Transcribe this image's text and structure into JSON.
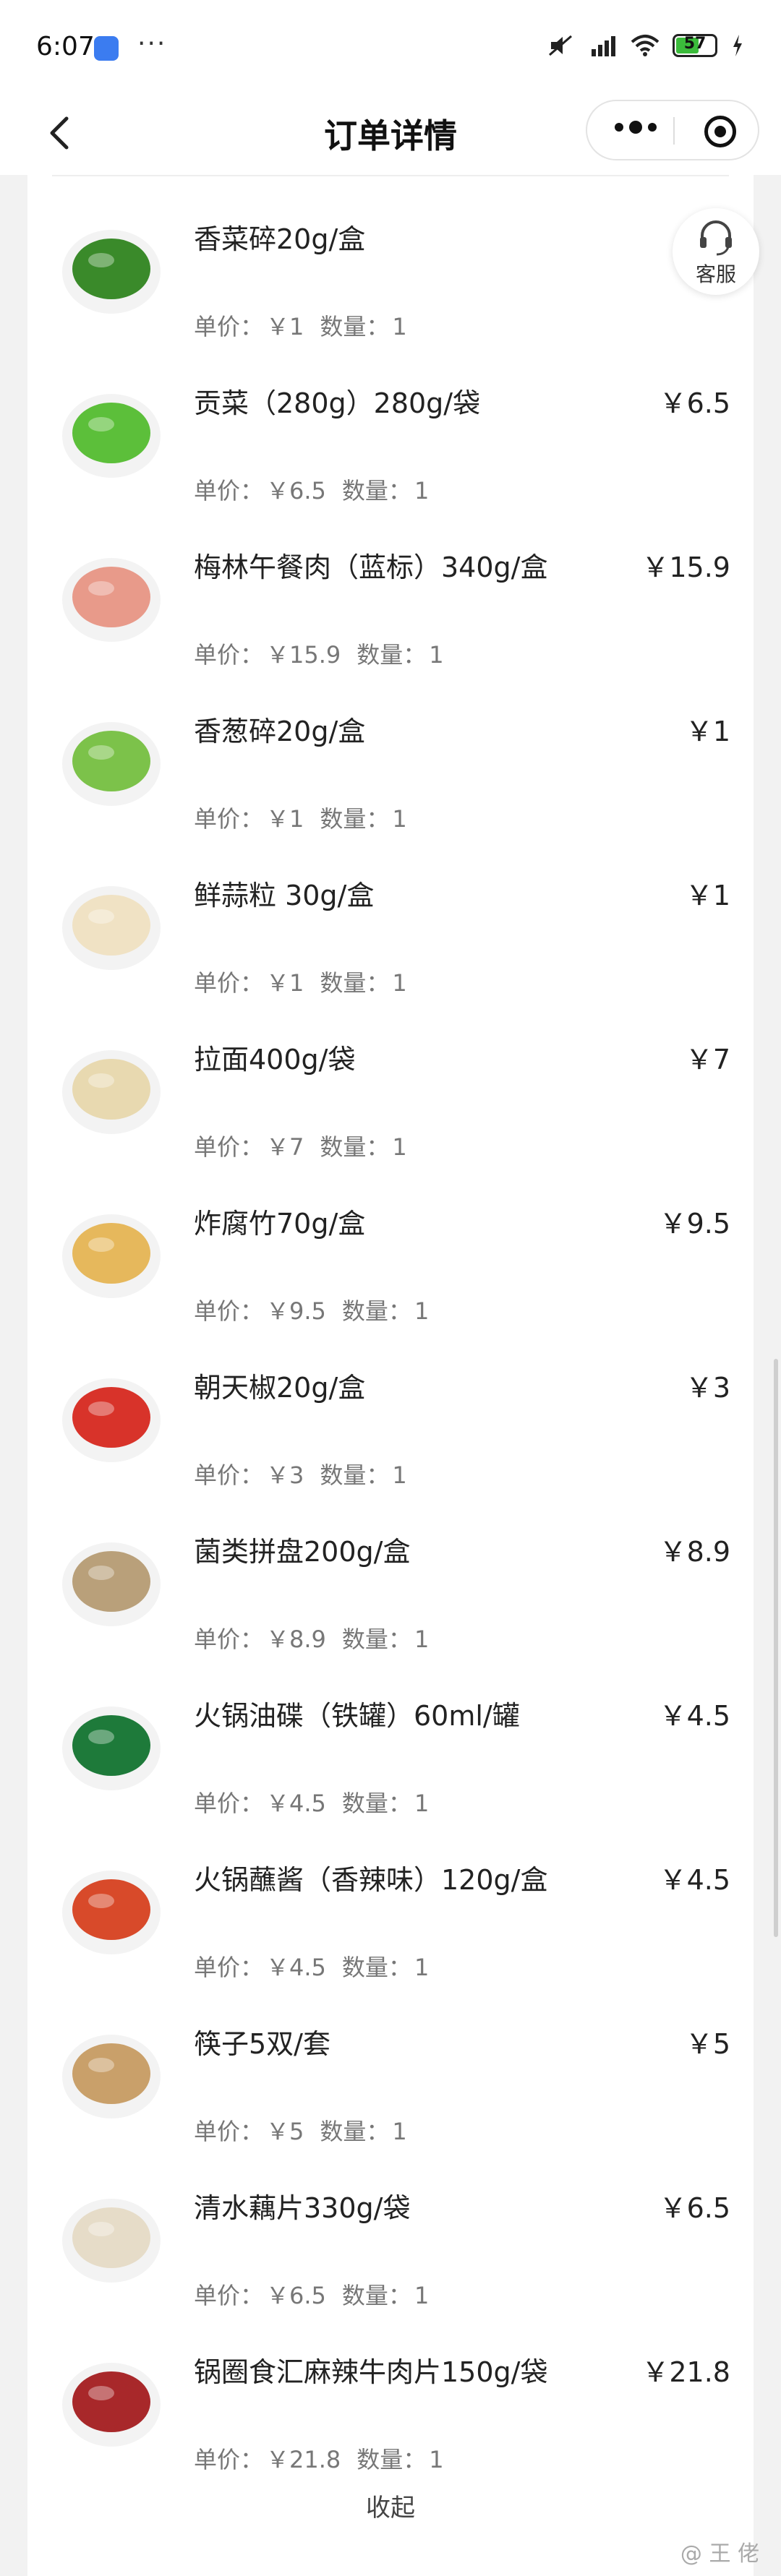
{
  "status": {
    "time": "6:07",
    "dots": "···",
    "network": "HD",
    "battery": "57"
  },
  "nav": {
    "title": "订单详情"
  },
  "service": {
    "label": "客服"
  },
  "items": [
    {
      "name": "香菜碎20g/盒",
      "price": "",
      "unit_label": "单价：",
      "unit_price": "￥1",
      "qty_label": "数量：",
      "qty": "1",
      "color": "#3a8a2a"
    },
    {
      "name": "贡菜（280g）280g/袋",
      "price": "￥6.5",
      "unit_label": "单价：",
      "unit_price": "￥6.5",
      "qty_label": "数量：",
      "qty": "1",
      "color": "#5cbf3a"
    },
    {
      "name": "梅林午餐肉（蓝标）340g/盒",
      "price": "￥15.9",
      "unit_label": "单价：",
      "unit_price": "￥15.9",
      "qty_label": "数量：",
      "qty": "1",
      "color": "#e89a8a"
    },
    {
      "name": "香葱碎20g/盒",
      "price": "￥1",
      "unit_label": "单价：",
      "unit_price": "￥1",
      "qty_label": "数量：",
      "qty": "1",
      "color": "#7cc24a"
    },
    {
      "name": "鲜蒜粒 30g/盒",
      "price": "￥1",
      "unit_label": "单价：",
      "unit_price": "￥1",
      "qty_label": "数量：",
      "qty": "1",
      "color": "#f0e2c4"
    },
    {
      "name": "拉面400g/袋",
      "price": "￥7",
      "unit_label": "单价：",
      "unit_price": "￥7",
      "qty_label": "数量：",
      "qty": "1",
      "color": "#e8d9b0"
    },
    {
      "name": "炸腐竹70g/盒",
      "price": "￥9.5",
      "unit_label": "单价：",
      "unit_price": "￥9.5",
      "qty_label": "数量：",
      "qty": "1",
      "color": "#e6b85c"
    },
    {
      "name": "朝天椒20g/盒",
      "price": "￥3",
      "unit_label": "单价：",
      "unit_price": "￥3",
      "qty_label": "数量：",
      "qty": "1",
      "color": "#d8332a"
    },
    {
      "name": "菌类拼盘200g/盒",
      "price": "￥8.9",
      "unit_label": "单价：",
      "unit_price": "￥8.9",
      "qty_label": "数量：",
      "qty": "1",
      "color": "#b9a07a"
    },
    {
      "name": "火锅油碟（铁罐）60ml/罐",
      "price": "￥4.5",
      "unit_label": "单价：",
      "unit_price": "￥4.5",
      "qty_label": "数量：",
      "qty": "1",
      "color": "#1e7a3a"
    },
    {
      "name": "火锅蘸酱（香辣味）120g/盒",
      "price": "￥4.5",
      "unit_label": "单价：",
      "unit_price": "￥4.5",
      "qty_label": "数量：",
      "qty": "1",
      "color": "#d84a2a"
    },
    {
      "name": "筷子5双/套",
      "price": "￥5",
      "unit_label": "单价：",
      "unit_price": "￥5",
      "qty_label": "数量：",
      "qty": "1",
      "color": "#c9a06a"
    },
    {
      "name": "清水藕片330g/袋",
      "price": "￥6.5",
      "unit_label": "单价：",
      "unit_price": "￥6.5",
      "qty_label": "数量：",
      "qty": "1",
      "color": "#e6dcc8"
    },
    {
      "name": "锅圈食汇麻辣牛肉片150g/袋",
      "price": "￥21.8",
      "unit_label": "单价：",
      "unit_price": "￥21.8",
      "qty_label": "数量：",
      "qty": "1",
      "color": "#a8282a"
    }
  ],
  "collapse_label": "收起",
  "watermark": "@ 王 佬"
}
